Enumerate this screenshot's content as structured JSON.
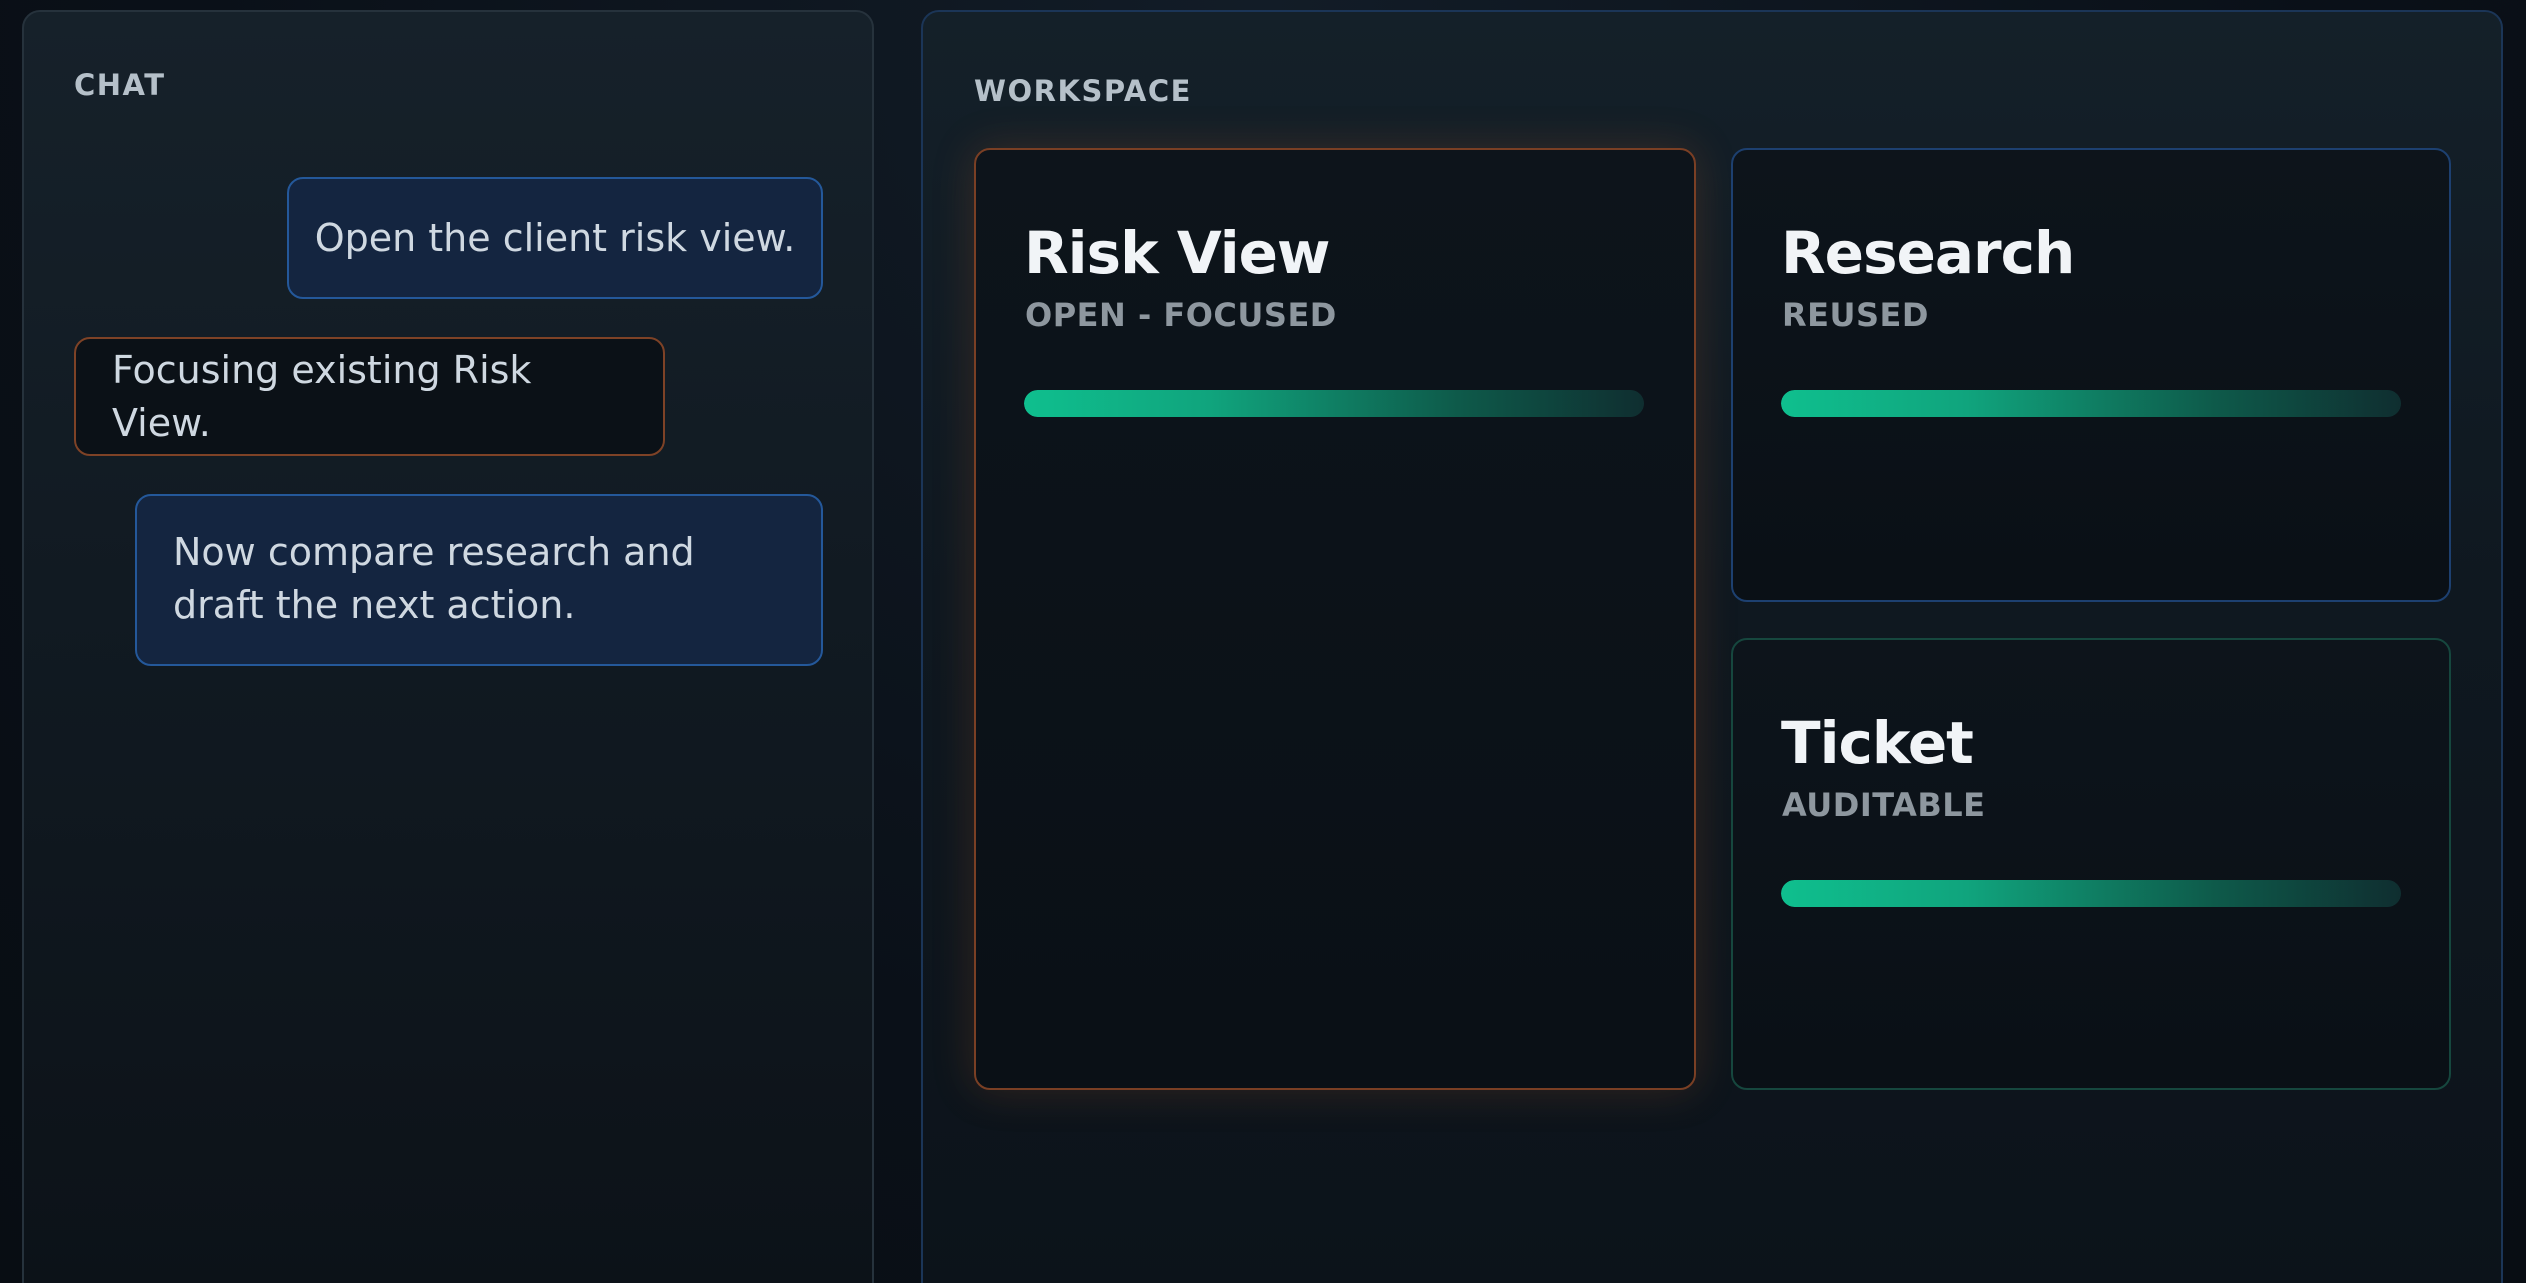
{
  "chat": {
    "heading": "CHAT",
    "messages": [
      {
        "role": "user",
        "text": "Open the client risk view."
      },
      {
        "role": "assistant",
        "text": "Focusing existing Risk View."
      },
      {
        "role": "user",
        "text": "Now compare research and draft the next action."
      }
    ]
  },
  "workspace": {
    "heading": "WORKSPACE",
    "cards": [
      {
        "title": "Risk View",
        "status": "OPEN - FOCUSED",
        "progress": 1.0,
        "accent": "#c0602a"
      },
      {
        "title": "Research",
        "status": "REUSED",
        "progress": 1.0,
        "accent": "#2a5fa5"
      },
      {
        "title": "Ticket",
        "status": "AUDITABLE",
        "progress": 1.0,
        "accent": "#1b6b5a"
      }
    ]
  },
  "colors": {
    "user_bubble_border": "#24589a",
    "assistant_bubble_border": "#7e4226",
    "progress_start": "#0fbf8e",
    "progress_end": "#0f2e30"
  }
}
